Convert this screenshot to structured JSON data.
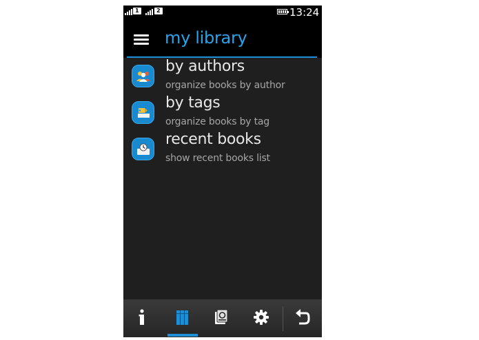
{
  "status_bar": {
    "sim1": "1",
    "sim2": "2",
    "time": "13:24"
  },
  "header": {
    "title": "my library"
  },
  "menu": {
    "items": [
      {
        "title": "by authors",
        "subtitle": "organize books by author",
        "icon": "people-icon"
      },
      {
        "title": "by tags",
        "subtitle": "organize books by tag",
        "icon": "tag-icon"
      },
      {
        "title": "recent books",
        "subtitle": "show recent books list",
        "icon": "recent-books-icon"
      }
    ]
  },
  "toolbar": {
    "buttons": [
      {
        "icon": "info-icon",
        "active": false
      },
      {
        "icon": "library-icon",
        "active": true
      },
      {
        "icon": "catalog-icon",
        "active": false
      },
      {
        "icon": "settings-icon",
        "active": false
      },
      {
        "icon": "back-icon",
        "active": false
      }
    ]
  },
  "colors": {
    "accent": "#1c8fd6",
    "title": "#2aa3ea",
    "background": "#1f1f1f",
    "header": "#000000"
  }
}
